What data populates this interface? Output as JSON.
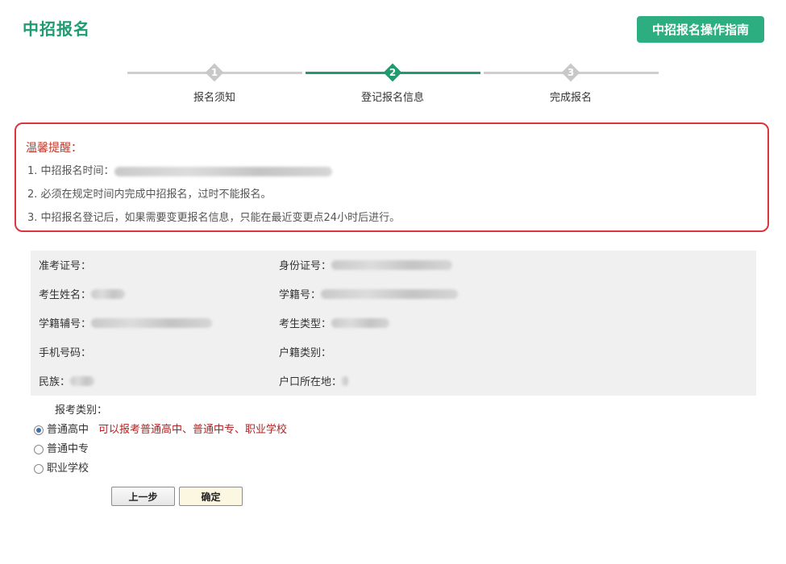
{
  "header": {
    "title": "中招报名",
    "guide_button": "中招报名操作指南"
  },
  "steps": [
    {
      "number": "1",
      "label": "报名须知",
      "state": "done"
    },
    {
      "number": "2",
      "label": "登记报名信息",
      "state": "active"
    },
    {
      "number": "3",
      "label": "完成报名",
      "state": "pending"
    }
  ],
  "colors": {
    "accent": "#1f9b6f",
    "button_green": "#2cae80",
    "notice_border": "#d9363e",
    "notice_title": "#c0392b",
    "hint_red": "#b22222"
  },
  "notice": {
    "title": "温馨提醒：",
    "items": [
      "1. 中招报名时间：",
      "2. 必须在规定时间内完成中招报名，过时不能报名。",
      "3. 中招报名登记后，如果需要变更报名信息，只能在最近变更点24小时后进行。"
    ]
  },
  "info": {
    "admission_ticket": {
      "label": "准考证号："
    },
    "id_number": {
      "label": "身份证号："
    },
    "student_name": {
      "label": "考生姓名："
    },
    "student_registry": {
      "label": "学籍号："
    },
    "registry_aux": {
      "label": "学籍辅号："
    },
    "student_type": {
      "label": "考生类型："
    },
    "phone": {
      "label": "手机号码："
    },
    "household_type": {
      "label": "户籍类别："
    },
    "ethnicity": {
      "label": "民族："
    },
    "household_location": {
      "label": "户口所在地："
    }
  },
  "apply": {
    "label": "报考类别：",
    "options": [
      {
        "label": "普通高中",
        "checked": true,
        "hint": "可以报考普通高中、普通中专、职业学校"
      },
      {
        "label": "普通中专",
        "checked": false
      },
      {
        "label": "职业学校",
        "checked": false
      }
    ]
  },
  "buttons": {
    "prev": "上一步",
    "confirm": "确定"
  }
}
